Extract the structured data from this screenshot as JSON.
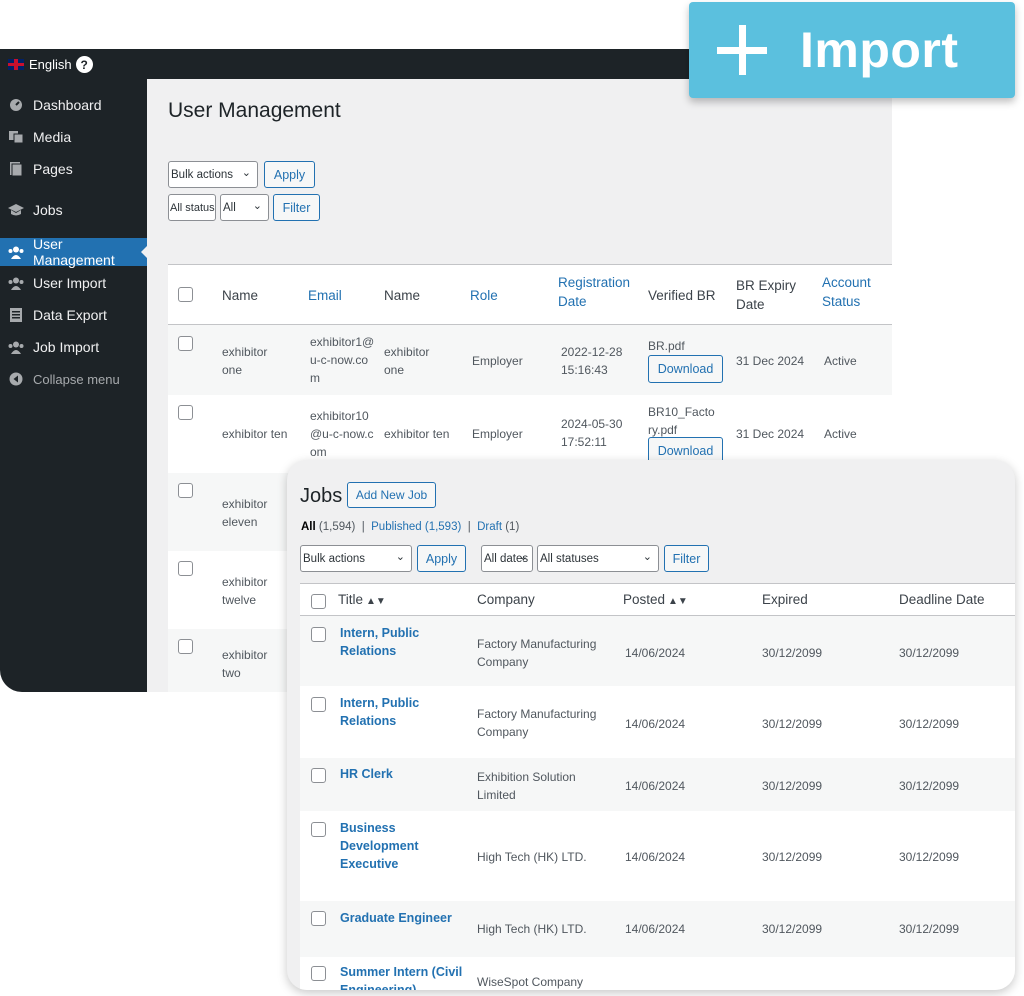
{
  "topbar": {
    "language": "English",
    "help": "?"
  },
  "sidebar": {
    "items": [
      {
        "label": "Dashboard",
        "icon": "dashboard-icon"
      },
      {
        "label": "Media",
        "icon": "media-icon"
      },
      {
        "label": "Pages",
        "icon": "pages-icon"
      },
      {
        "label": "Jobs",
        "icon": "jobs-icon"
      },
      {
        "label": "User Management",
        "icon": "users-icon",
        "active": true
      },
      {
        "label": "User Import",
        "icon": "users-icon"
      },
      {
        "label": "Data Export",
        "icon": "document-icon"
      },
      {
        "label": "Job Import",
        "icon": "users-icon"
      },
      {
        "label": "Collapse menu",
        "icon": "collapse-icon"
      }
    ]
  },
  "user_management": {
    "title": "User Management",
    "bulk_actions": "Bulk actions",
    "apply": "Apply",
    "status_filter": "All status",
    "all": "All",
    "filter": "Filter",
    "columns": [
      "Name",
      "Email",
      "Name",
      "Role",
      "Registration Date",
      "Verified BR",
      "BR Expiry Date",
      "Account Status"
    ],
    "rows": [
      {
        "name": "exhibitor one",
        "email": "exhibitor1@u-c-now.com",
        "name2": "exhibitor one",
        "role": "Employer",
        "date": "2022-12-28 15:16:43",
        "br": "BR.pdf",
        "download": "Download",
        "expiry": "31 Dec 2024",
        "status": "Active"
      },
      {
        "name": "exhibitor ten",
        "email": "exhibitor10@u-c-now.com",
        "name2": "exhibitor ten",
        "role": "Employer",
        "date": "2024-05-30 17:52:11",
        "br": "BR10_Factory.pdf",
        "download": "Download",
        "expiry": "31 Dec 2024",
        "status": "Active"
      },
      {
        "name": "exhibitor eleven"
      },
      {
        "name": "exhibitor twelve"
      },
      {
        "name": "exhibitor two"
      }
    ]
  },
  "import_button": {
    "label": "Import",
    "color": "#5bc0de"
  },
  "jobs": {
    "title": "Jobs",
    "add_new": "Add New Job",
    "filters": {
      "all": "All",
      "all_count": "(1,594)",
      "published": "Published",
      "published_count": "(1,593)",
      "draft": "Draft",
      "draft_count": "(1)"
    },
    "bulk_actions": "Bulk actions",
    "apply": "Apply",
    "all_dates": "All dates",
    "all_statuses": "All statuses",
    "filter": "Filter",
    "columns": [
      "Title",
      "Company",
      "Posted",
      "Expired",
      "Deadline Date"
    ],
    "rows": [
      {
        "title": "Intern, Public Relations",
        "company": "Factory Manufacturing Company",
        "posted": "14/06/2024",
        "expired": "30/12/2099",
        "deadline": "30/12/2099"
      },
      {
        "title": "Intern, Public Relations",
        "company": "Factory Manufacturing Company",
        "posted": "14/06/2024",
        "expired": "30/12/2099",
        "deadline": "30/12/2099"
      },
      {
        "title": "HR Clerk",
        "company": "Exhibition Solution Limited",
        "posted": "14/06/2024",
        "expired": "30/12/2099",
        "deadline": "30/12/2099"
      },
      {
        "title": "Business Development Executive",
        "company": "High Tech (HK) LTD.",
        "posted": "14/06/2024",
        "expired": "30/12/2099",
        "deadline": "30/12/2099"
      },
      {
        "title": "Graduate Engineer",
        "company": "High Tech (HK) LTD.",
        "posted": "14/06/2024",
        "expired": "30/12/2099",
        "deadline": "30/12/2099"
      },
      {
        "title": "Summer Intern (Civil Engineering)",
        "company": "WiseSpot Company"
      }
    ]
  }
}
